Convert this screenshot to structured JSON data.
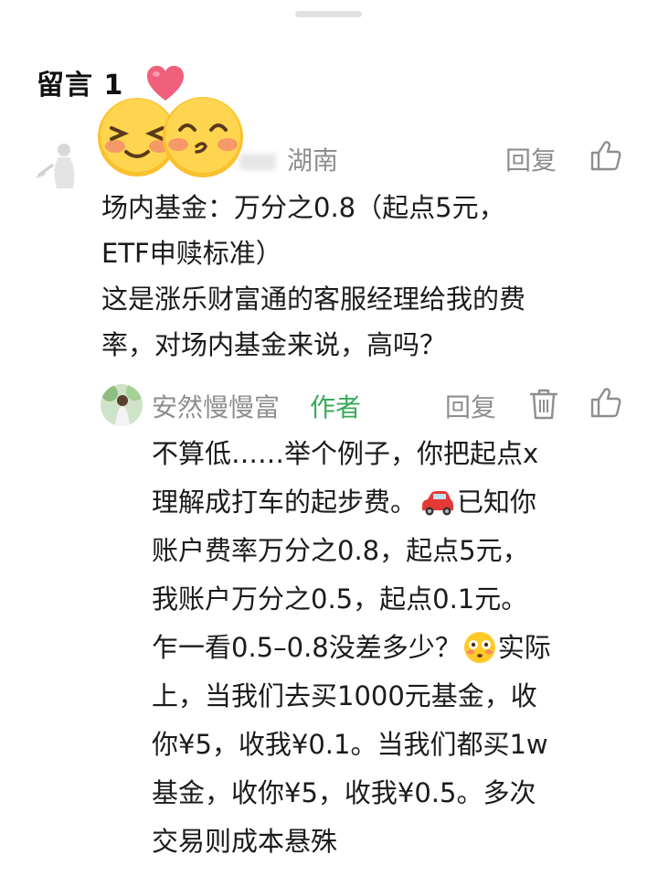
{
  "header": {
    "title": "留言 1"
  },
  "comment": {
    "location": "湖南",
    "reply_label": "回复",
    "lines": [
      "场内基金：万分之0.8（起点5元，",
      "ETF申赎标准）",
      "这是涨乐财富通的客服经理给我的费",
      "率，对场内基金来说，高吗？"
    ]
  },
  "reply": {
    "author": "安然慢慢富",
    "author_tag": "作者",
    "reply_label": "回复",
    "lines": {
      "l1": "不算低……举个例子，你把起点x",
      "l2a": "理解成打车的起步费。",
      "l2b": "已知你",
      "l3": "账户费率万分之0.8，起点5元，",
      "l4": "我账户万分之0.5，起点0.1元。",
      "l5a": "乍一看0.5–0.8没差多少？",
      "l5b": "实际",
      "l6": "上，当我们去买1000元基金，收",
      "l7": "你¥5，收我¥0.1。当我们都买1w",
      "l8": "基金，收你¥5，收我¥0.5。多次",
      "l9": "交易则成本悬殊"
    }
  },
  "icons": {
    "heart": "heart-icon",
    "stickers": [
      "laughing-blush-emoji",
      "kissing-blush-emoji"
    ],
    "like": "thumbs-up-icon",
    "delete": "trash-icon",
    "car": "car-emoji",
    "flushed": "flushed-face-emoji"
  },
  "colors": {
    "meta_gray": "#8e8e8e",
    "author_tag": "#3aa85a",
    "text": "#1b1b1b"
  }
}
